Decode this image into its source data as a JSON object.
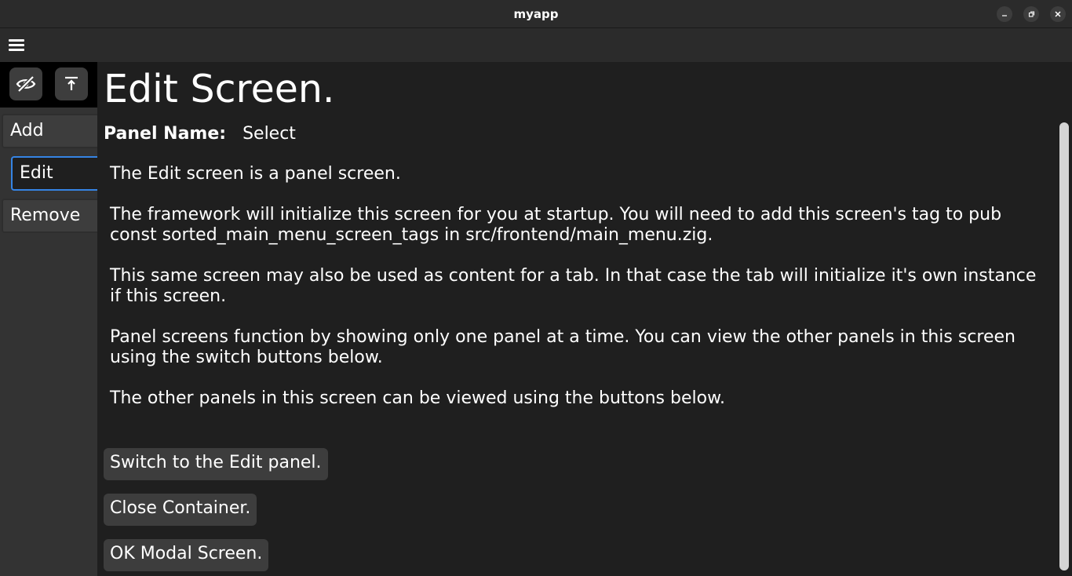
{
  "window": {
    "title": "myapp",
    "controls": [
      "minimize-icon",
      "maximize-icon",
      "close-icon"
    ]
  },
  "menubar": {
    "icon": "hamburger-menu-icon"
  },
  "sidebar": {
    "icon_buttons": [
      {
        "icon": "eye-slash-icon"
      },
      {
        "icon": "arrow-up-to-line-icon"
      }
    ],
    "tabs": [
      {
        "label": "Add",
        "active": false
      },
      {
        "label": "Edit",
        "active": true
      },
      {
        "label": "Remove",
        "active": false
      }
    ]
  },
  "main": {
    "heading": "Edit Screen.",
    "panel_name_label": "Panel Name:",
    "panel_name_value": "Select",
    "paragraphs": [
      "The Edit screen is a panel screen.",
      "The framework will initialize this screen for you at startup. You will need to add this screen's tag to pub const sorted_main_menu_screen_tags in src/frontend/main_menu.zig.",
      "This same screen may also be used as content for a tab. In that case the tab will initialize it's own instance if this screen.",
      "Panel screens function by showing only one panel at a time. You can view the other panels in this screen using the switch buttons below.",
      "The other panels in this screen can be viewed using the buttons below."
    ],
    "buttons": [
      "Switch to the Edit panel.",
      "Close Container.",
      "OK Modal Screen."
    ]
  },
  "colors": {
    "background": "#1f1f1f",
    "titlebar": "#2b2b2b",
    "sidebar": "#333333",
    "button": "#3d3d3d",
    "accent": "#3584e4",
    "text": "#ffffff"
  }
}
